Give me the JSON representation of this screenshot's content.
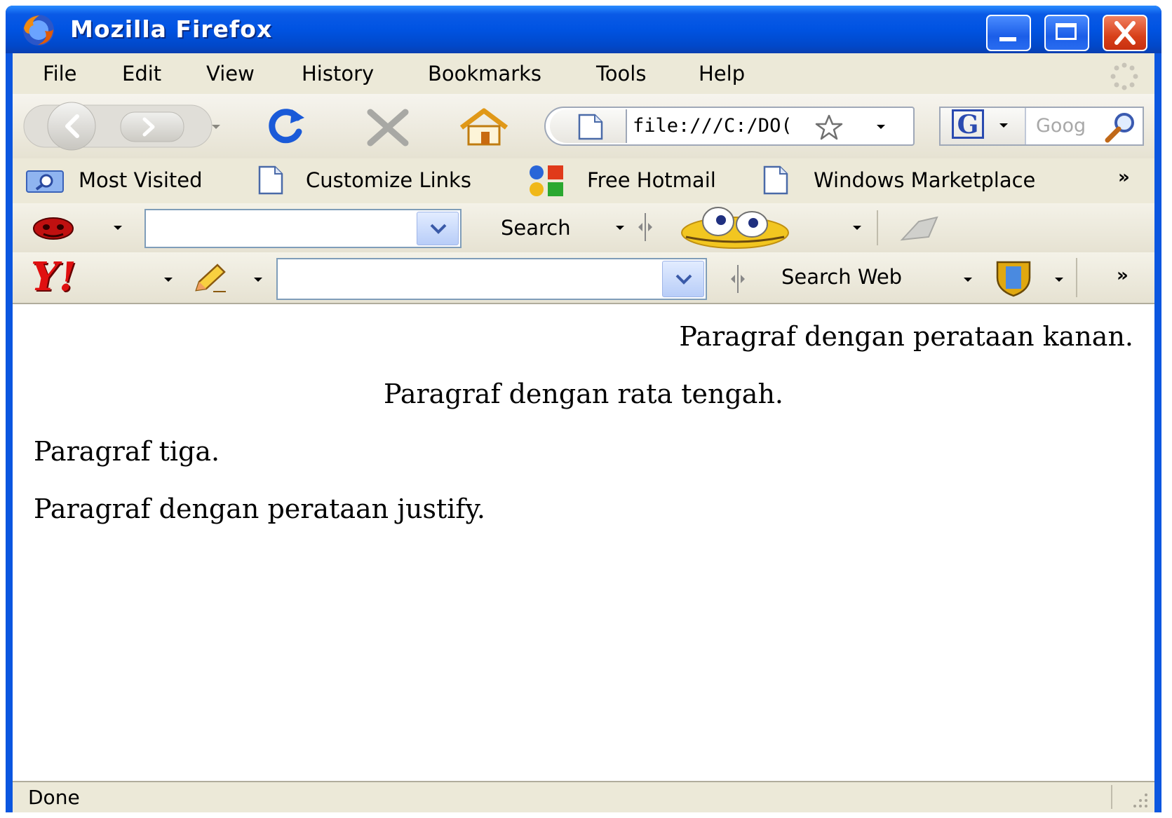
{
  "window": {
    "title": "Mozilla Firefox"
  },
  "menu": [
    "File",
    "Edit",
    "View",
    "History",
    "Bookmarks",
    "Tools",
    "Help"
  ],
  "navigation": {
    "address_value": "file:///C:/DO(",
    "search_placeholder": "Goog",
    "search_engine_letter": "G"
  },
  "bookmarks": [
    {
      "label": "Most Visited",
      "icon": "magnifier-folder-icon"
    },
    {
      "label": "Customize Links",
      "icon": "page-icon"
    },
    {
      "label": "Free Hotmail",
      "icon": "msn-icon"
    },
    {
      "label": "Windows Marketplace",
      "icon": "page-icon"
    }
  ],
  "toolbar1": {
    "search_label": "Search"
  },
  "toolbar2": {
    "logo": "Y!",
    "search_label": "Search Web"
  },
  "content": {
    "paragraphs": [
      {
        "text": "Paragraf dengan perataan kanan.",
        "align": "right"
      },
      {
        "text": "Paragraf dengan rata tengah.",
        "align": "center"
      },
      {
        "text": "Paragraf tiga.",
        "align": "left"
      },
      {
        "text": "Paragraf dengan perataan justify.",
        "align": "justify"
      }
    ]
  },
  "status": {
    "text": "Done"
  },
  "overflow_chevron": "»",
  "colors": {
    "title_bar": "#0a5ae6",
    "chrome": "#ece9d8",
    "close_button": "#d8401a"
  }
}
